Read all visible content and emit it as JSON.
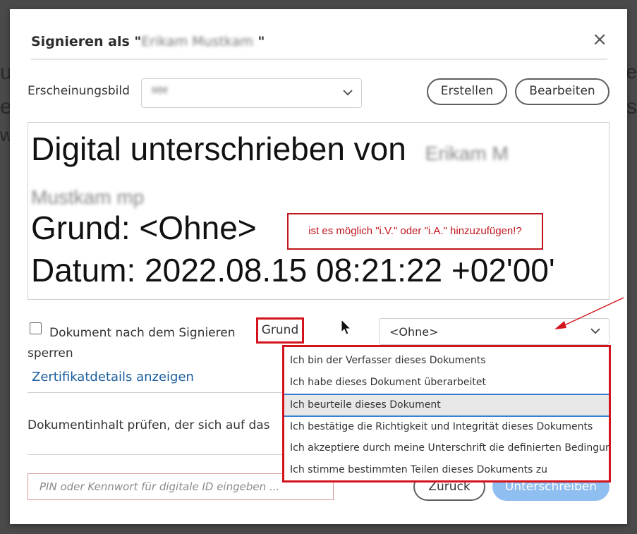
{
  "dialog": {
    "title_prefix": "Signieren als \"",
    "title_name": "Erikam Mustkam",
    "title_suffix": " \"",
    "close_label": "×"
  },
  "appearance": {
    "label": "Erscheinungsbild",
    "selected_value": "MM",
    "create_label": "Erstellen",
    "edit_label": "Bearbeiten"
  },
  "preview": {
    "line1": "Digital unterschrieben von",
    "name_part1": "Erikam M",
    "name_part2": "Mustkam mp",
    "line3": "Grund: <Ohne>",
    "line4": "Datum: 2022.08.15 08:21:22 +02'00'",
    "annotation": "ist es möglich \"i.V.\" oder \"i.A.\" hinzuzufügen!?"
  },
  "lock": {
    "label_line1": "Dokument nach dem Signieren",
    "label_line2": "sperren",
    "checked": false
  },
  "reason": {
    "label": "Grund",
    "selected_value": "<Ohne>",
    "options": [
      "Ich bin der Verfasser dieses Dokuments",
      "Ich habe dieses Dokument überarbeitet",
      "Ich beurteile dieses Dokument",
      "Ich bestätige die Richtigkeit und Integrität dieses Dokuments",
      "Ich akzeptiere durch meine Unterschrift die definierten Bedingungen",
      "Ich stimme bestimmten Teilen dieses Dokuments zu"
    ]
  },
  "cert_link": "Zertifikatdetails anzeigen",
  "review_text": "Dokumentinhalt prüfen, der sich auf das",
  "pin": {
    "placeholder": "PIN oder Kennwort für digitale ID eingeben ..."
  },
  "footer": {
    "back_label": "Zurück",
    "sign_label": "Unterschreiben"
  },
  "background_text": [
    "uf",
    "e",
    "w",
    "ns",
    "fe"
  ],
  "colors": {
    "annotation_red": "#d4141c",
    "link_blue": "#1a5d9e",
    "sign_button": "#8fbef0",
    "highlight_blue": "#3b7fd0"
  }
}
